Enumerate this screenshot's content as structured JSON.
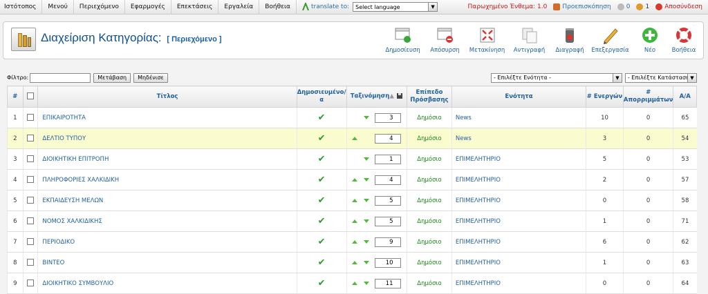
{
  "menu": {
    "items": [
      "Ιστότοπος",
      "Μενού",
      "Περιεχόμενο",
      "Εφαρμογές",
      "Επεκτάσεις",
      "Εργαλεία",
      "Βοήθεια"
    ],
    "translate_label": "translate to:",
    "language_select": "Select language"
  },
  "status": {
    "expired": "Παρωχημένο Ένθεμα: 1.0",
    "preview": "Προεπισκόπηση",
    "messages": "0",
    "users": "1",
    "logout": "Αποσύνδεση"
  },
  "header": {
    "title": "Διαχείριση Κατηγορίας:",
    "subtitle": "[ Περιεχόμενο ]"
  },
  "toolbar": {
    "buttons": [
      {
        "label": "Δημοσίευση",
        "icon": "publish-icon"
      },
      {
        "label": "Απόσυρση",
        "icon": "unpublish-icon"
      },
      {
        "label": "Μετακίνηση",
        "icon": "move-icon"
      },
      {
        "label": "Αντιγραφή",
        "icon": "copy-icon"
      },
      {
        "label": "Διαγραφή",
        "icon": "delete-icon"
      },
      {
        "label": "Επεξεργασία",
        "icon": "edit-icon"
      },
      {
        "label": "Νέο",
        "icon": "new-icon"
      },
      {
        "label": "Βοήθεια",
        "icon": "help-icon"
      }
    ]
  },
  "filter": {
    "label": "Φίλτρο:",
    "value": "",
    "go_button": "Μετάβαση",
    "reset_button": "Μηδένισε",
    "section_select": "- Επιλέξτε Ενότητα -",
    "state_select": "- Επιλέξτε Κατάσταση -"
  },
  "table": {
    "headers": {
      "num": "#",
      "title": "Τίτλος",
      "published": "Δημοσιευμένο/α",
      "ordering": "Ταξινόμηση",
      "access": "Επίπεδο Πρόσβασης",
      "section": "Ενότητα",
      "active": "# Ενεργών",
      "trashed": "# Απορριμμάτων",
      "id": "Α/Α"
    },
    "rows": [
      {
        "n": "1",
        "title": "ΕΠΙΚΑΙΡΟΤΗΤΑ",
        "order": "3",
        "access": "Δημόσιο",
        "section": "News",
        "active": "10",
        "trashed": "0",
        "id": "65",
        "up": false,
        "down": true
      },
      {
        "n": "2",
        "title": "ΔΕΛΤΙΟ ΤΥΠΟΥ",
        "order": "4",
        "access": "Δημόσιο",
        "section": "News",
        "active": "3",
        "trashed": "0",
        "id": "54",
        "up": true,
        "down": false
      },
      {
        "n": "3",
        "title": "ΔΙΟΙΚΗΤΙΚΗ ΕΠΙΤΡΟΠΗ",
        "order": "1",
        "access": "Δημόσιο",
        "section": "ΕΠΙΜΕΛΗΤΗΡΙΟ",
        "active": "5",
        "trashed": "0",
        "id": "53",
        "up": false,
        "down": true
      },
      {
        "n": "4",
        "title": "ΠΛΗΡΟΦΟΡΙΕΣ ΧΑΛΚΙΔΙΚΗ",
        "order": "4",
        "access": "Δημόσιο",
        "section": "ΕΠΙΜΕΛΗΤΗΡΙΟ",
        "active": "2",
        "trashed": "0",
        "id": "57",
        "up": true,
        "down": true
      },
      {
        "n": "5",
        "title": "ΕΚΠΑΙΔΕΥΣΗ ΜΕΛΩΝ",
        "order": "5",
        "access": "Δημόσιο",
        "section": "ΕΠΙΜΕΛΗΤΗΡΙΟ",
        "active": "0",
        "trashed": "0",
        "id": "58",
        "up": true,
        "down": true
      },
      {
        "n": "6",
        "title": "ΝΟΜΟΣ ΧΑΛΚΙΔΙΚΗΣ",
        "order": "5",
        "access": "Δημόσιο",
        "section": "ΕΠΙΜΕΛΗΤΗΡΙΟ",
        "active": "1",
        "trashed": "0",
        "id": "71",
        "up": true,
        "down": true
      },
      {
        "n": "7",
        "title": "ΠΕΡΙΟΔΙΚΟ",
        "order": "9",
        "access": "Δημόσιο",
        "section": "ΕΠΙΜΕΛΗΤΗΡΙΟ",
        "active": "6",
        "trashed": "0",
        "id": "62",
        "up": true,
        "down": true
      },
      {
        "n": "8",
        "title": "ΒΙΝΤΕΟ",
        "order": "10",
        "access": "Δημόσιο",
        "section": "ΕΠΙΜΕΛΗΤΗΡΙΟ",
        "active": "1",
        "trashed": "0",
        "id": "63",
        "up": true,
        "down": true
      },
      {
        "n": "9",
        "title": "ΔΙΟΙΚΗΤΙΚΟ ΣΥΜΒΟΥΛΙΟ",
        "order": "11",
        "access": "Δημόσιο",
        "section": "ΕΠΙΜΕΛΗΤΗΡΙΟ",
        "active": "0",
        "trashed": "0",
        "id": "64",
        "up": true,
        "down": true
      }
    ]
  },
  "colors": {
    "accent": "#1f5f9e",
    "highlight_row": "#fbfbd0",
    "access_green": "#1a8a1a",
    "check_green": "#2a9a2a"
  }
}
